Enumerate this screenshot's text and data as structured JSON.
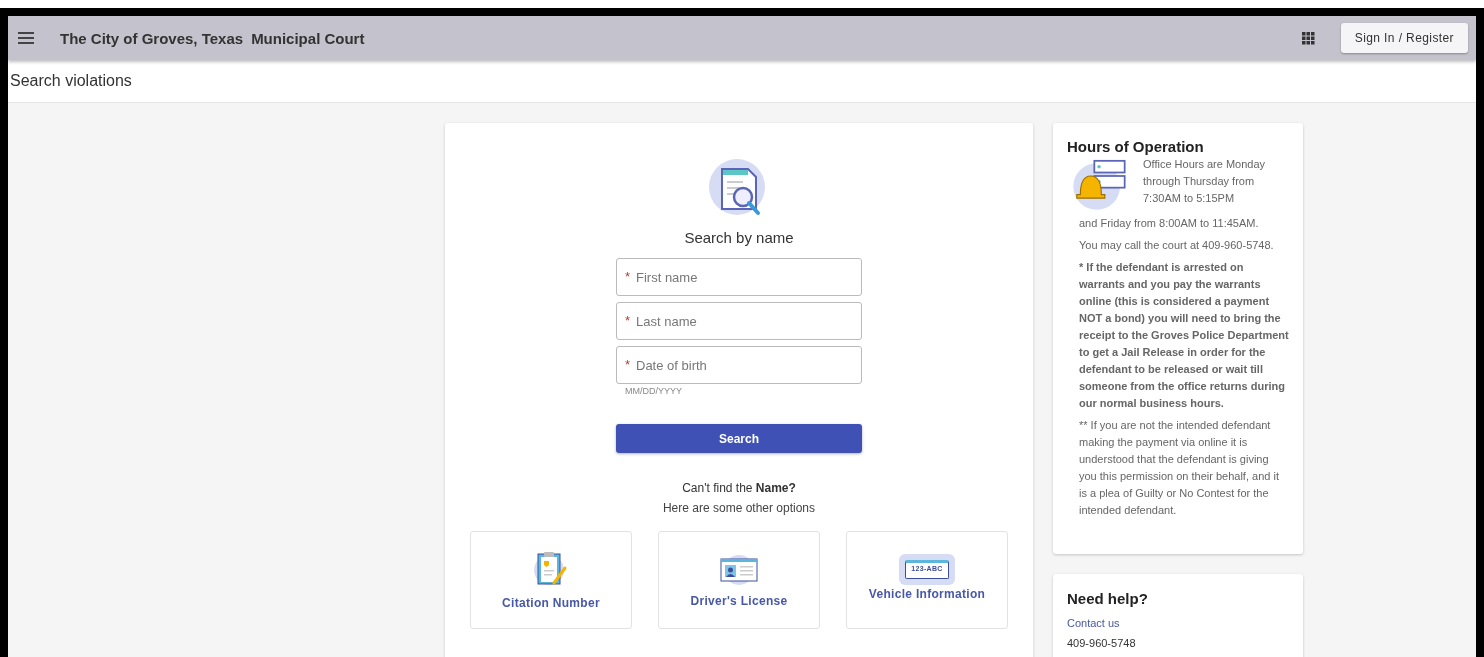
{
  "header": {
    "title": "The City of Groves, Texas",
    "subtitle": "Municipal Court",
    "sign_in": "Sign In / Register"
  },
  "page_title": "Search violations",
  "search": {
    "heading": "Search by name",
    "fields": [
      {
        "placeholder": "First name",
        "required_mark": "*"
      },
      {
        "placeholder": "Last name",
        "required_mark": "*"
      },
      {
        "placeholder": "Date of birth",
        "required_mark": "*",
        "hint": "MM/DD/YYYY"
      }
    ],
    "button": "Search",
    "alt_prompt": "Can't find the **Name?**",
    "alt_sub": "Here are some other options",
    "options": [
      {
        "kind": "citation",
        "label": "Citation Number"
      },
      {
        "kind": "license",
        "label": "Driver's License"
      },
      {
        "kind": "vehicle",
        "label": "Vehicle Information",
        "plate": "123-ABC"
      }
    ]
  },
  "hours": {
    "title": "Hours of Operation",
    "intro": "Office Hours are Monday through Thursday from 7:30AM to 5:15PM",
    "paragraphs": [
      {
        "text": "and Friday from 8:00AM to 11:45AM.",
        "bold": false
      },
      {
        "text": "You may call the court at 409-960-5748.",
        "bold": false
      },
      {
        "text": "* If the defendant is arrested on warrants and you pay the warrants online (this is considered a payment NOT a bond) you will need to bring the receipt to the Groves Police Department to get a Jail Release in order for the defendant to be released or wait till someone from the office returns during our normal business hours.",
        "bold": true
      },
      {
        "text": "** If you are not the intended defendant making the payment via online it is understood that the defendant is giving you this permission on their behalf, and it is a plea of Guilty or No Contest for the intended defendant.",
        "bold": false
      }
    ]
  },
  "help": {
    "title": "Need help?",
    "link": "Contact us",
    "phone": "409-960-5748"
  }
}
